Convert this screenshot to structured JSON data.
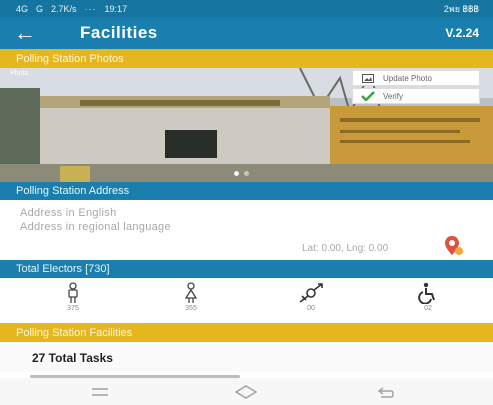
{
  "status_bar": {
    "left_text": "4G",
    "network": "G",
    "speed": "2.7K/s",
    "dots": "···",
    "time": "19:17",
    "right_text": "2พย ฿฿฿"
  },
  "app_bar": {
    "back_label": "←",
    "title": "Facilities",
    "version": "V.2.24"
  },
  "photos_section": {
    "header": "Polling Station Photos",
    "photo_tag": "Photo",
    "update_photo_label": "Update Photo",
    "verify_label": "Verify"
  },
  "address_section": {
    "header": "Polling Station Address",
    "address_english": "Address in English",
    "address_regional": "Address in regional language",
    "latlng": "Lat: 0.00, Lng: 0.00"
  },
  "electors_section": {
    "header": "Total Electors [730]",
    "items": [
      {
        "icon": "male-voter-icon",
        "count": "375"
      },
      {
        "icon": "female-voter-icon",
        "count": "355"
      },
      {
        "icon": "third-gender-icon",
        "count": "00"
      },
      {
        "icon": "disabled-voter-icon",
        "count": "02"
      }
    ]
  },
  "facilities_section": {
    "header": "Polling Station Facilities",
    "tasks_label": "27 Total Tasks"
  },
  "colors": {
    "primary": "#1a7fae",
    "accent": "#e5b61d",
    "verify_green": "#3aa53a"
  }
}
